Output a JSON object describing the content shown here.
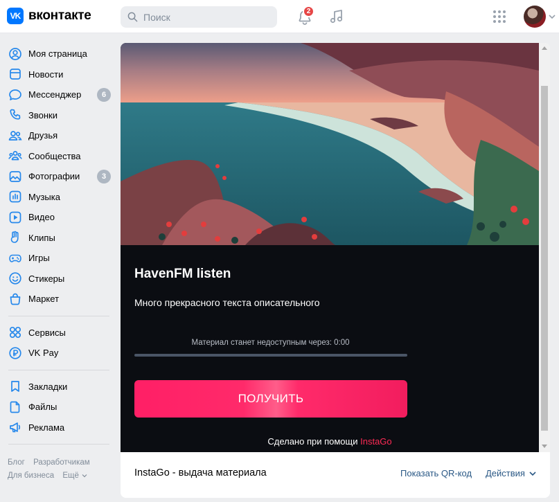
{
  "brand": {
    "logo_mark": "VK",
    "name": "вконтакте"
  },
  "header": {
    "search_placeholder": "Поиск",
    "notifications_count": "2",
    "icons": [
      "search-icon",
      "bell-icon",
      "music-icon",
      "apps-grid-icon",
      "chevron-down-icon"
    ]
  },
  "sidebar": {
    "main_items": [
      {
        "label": "Моя страница",
        "icon": "user-circle-icon"
      },
      {
        "label": "Новости",
        "icon": "news-icon"
      },
      {
        "label": "Мессенджер",
        "icon": "message-icon",
        "count": "6"
      },
      {
        "label": "Звонки",
        "icon": "phone-icon"
      },
      {
        "label": "Друзья",
        "icon": "friends-icon"
      },
      {
        "label": "Сообщества",
        "icon": "communities-icon"
      },
      {
        "label": "Фотографии",
        "icon": "photo-icon",
        "count": "3"
      },
      {
        "label": "Музыка",
        "icon": "music-bars-icon"
      },
      {
        "label": "Видео",
        "icon": "video-icon"
      },
      {
        "label": "Клипы",
        "icon": "clips-icon"
      },
      {
        "label": "Игры",
        "icon": "gamepad-icon"
      },
      {
        "label": "Стикеры",
        "icon": "smile-icon"
      },
      {
        "label": "Маркет",
        "icon": "market-bag-icon"
      }
    ],
    "service_items": [
      {
        "label": "Сервисы",
        "icon": "services-icon"
      },
      {
        "label": "VK Pay",
        "icon": "ruble-icon"
      }
    ],
    "extra_items": [
      {
        "label": "Закладки",
        "icon": "bookmark-icon"
      },
      {
        "label": "Файлы",
        "icon": "file-icon"
      },
      {
        "label": "Реклама",
        "icon": "megaphone-icon"
      }
    ],
    "footer": {
      "blog": "Блог",
      "developers": "Разработчикам",
      "business": "Для бизнеса",
      "more": "Ещё"
    }
  },
  "app": {
    "title": "HavenFM listen",
    "description": "Много прекрасного текста описательного",
    "timer_text": "Материал станет недоступным через: 0:00",
    "timer_progress": 0,
    "cta_label": "ПОЛУЧИТЬ",
    "made_with_prefix": "Сделано при помощи ",
    "made_with_brand": "InstaGo"
  },
  "card_footer": {
    "name": "InstaGo - выдача материала",
    "qr_label": "Показать QR-код",
    "actions_label": "Действия"
  },
  "colors": {
    "vk_blue": "#0077ff",
    "badge_red": "#e64646",
    "cta_pink": "#ff2a6a",
    "brand_red": "#ff2a55",
    "link": "#2a5885",
    "counter_gray": "#aeb7c2"
  }
}
